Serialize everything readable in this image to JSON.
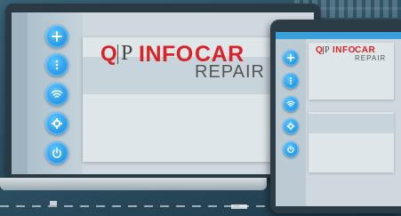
{
  "brand": {
    "qp": "Q",
    "p": "P",
    "info": "INFO",
    "car": "CAR",
    "repair": "REPAIR",
    "accent_color": "#d82226",
    "button_color": "#1e95e6"
  },
  "laptop": {
    "nav_icons": [
      "plus-icon",
      "more-vertical-icon",
      "wifi-icon",
      "settings-icon",
      "power-icon"
    ]
  },
  "tablet": {
    "nav_icons": [
      "plus-icon",
      "more-vertical-icon",
      "wifi-icon",
      "settings-icon",
      "power-icon"
    ]
  }
}
